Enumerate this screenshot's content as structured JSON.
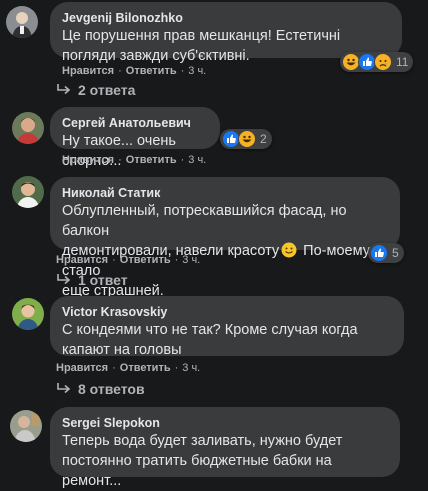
{
  "comments": [
    {
      "author": "Jevgenij Bilonozhko",
      "text": "Це порушення прав мешканця! Естетичні погляди завжди суб'єктивні.",
      "like": "Нравится",
      "reply": "Ответить",
      "time": "3 ч.",
      "reaction_count": "11",
      "reactions": [
        "laugh-icon",
        "like-icon",
        "sad-icon"
      ]
    },
    {
      "author": "Сергей Анатольевич",
      "text": "Ну такое... очень спорно...",
      "like": "Нравится",
      "reply": "Ответить",
      "time": "3 ч.",
      "reaction_count": "2",
      "reactions": [
        "like-icon",
        "laugh-icon"
      ]
    },
    {
      "author": "Николай Статик",
      "text_line1": "Облупленный, потрескавшийся фасад, но балкон",
      "text_line2": "демонтировали, навели красоту",
      "text_line2b": "По-моему стало",
      "text_line3": "еще страшней.",
      "like": "Нравится",
      "reply": "Ответить",
      "time": "3 ч.",
      "reaction_count": "5",
      "reactions": [
        "like-icon"
      ]
    },
    {
      "author": "Victor Krasovskiy",
      "text": "С кондеями что не так? Кроме случая когда капают на головы",
      "like": "Нравится",
      "reply": "Ответить",
      "time": "3 ч."
    },
    {
      "author": "Sergei Slepokon",
      "text": "Теперь вода будет заливать, нужно будет постоянно тратить бюджетные бабки на ремонт..."
    }
  ],
  "replies": {
    "r1": "2 ответа",
    "r3": "1 ответ",
    "r4": "8 ответов"
  },
  "colors": {
    "background": "#18191a",
    "bubble": "#3a3b3c",
    "muted_text": "#b0b3b8",
    "like_blue": "#1877f2"
  }
}
